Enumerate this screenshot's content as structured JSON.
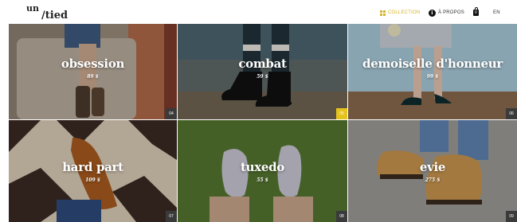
{
  "header": {
    "logo_top": "un",
    "logo_bottom": "/tied",
    "nav": {
      "collection": "COLLECTION",
      "apropos": "À PROPOS",
      "cart_count": "0",
      "lang": "EN"
    },
    "icons": [
      "grid-icon",
      "info-icon",
      "bag-icon"
    ],
    "accent_color": "#d4b52a"
  },
  "products": [
    {
      "name": "obsession",
      "price": "89 $",
      "num": "04",
      "active": false
    },
    {
      "name": "combat",
      "price": "59 $",
      "num": "05",
      "active": true
    },
    {
      "name": "demoiselle d'honneur",
      "price": "99 $",
      "num": "06",
      "active": false
    },
    {
      "name": "hard part",
      "price": "109 $",
      "num": "07",
      "active": false
    },
    {
      "name": "tuxedo",
      "price": "55 $",
      "num": "08",
      "active": false
    },
    {
      "name": "evie",
      "price": "275 $",
      "num": "09",
      "active": false
    }
  ]
}
